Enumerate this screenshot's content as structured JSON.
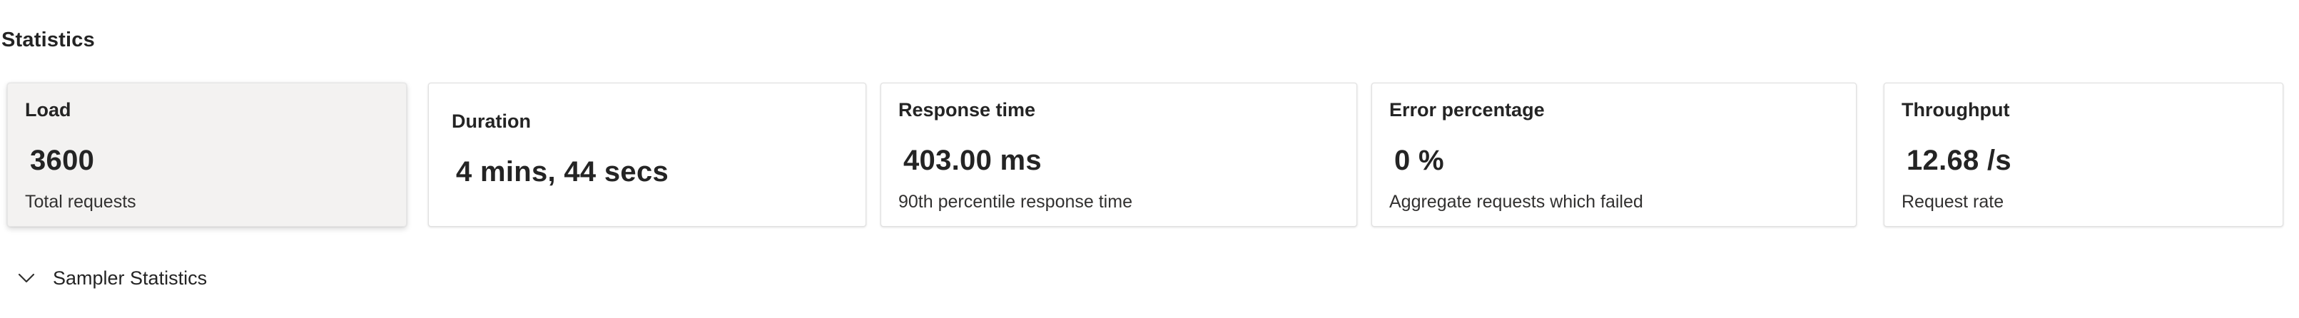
{
  "section": {
    "title": "Statistics"
  },
  "cards": [
    {
      "title": "Load",
      "value": "3600",
      "subtitle": "Total requests"
    },
    {
      "title": "Duration",
      "value": "4 mins, 44 secs",
      "subtitle": ""
    },
    {
      "title": "Response time",
      "value": "403.00 ms",
      "subtitle": "90th percentile response time"
    },
    {
      "title": "Error percentage",
      "value": "0 %",
      "subtitle": "Aggregate requests which failed"
    },
    {
      "title": "Throughput",
      "value": "12.68 /s",
      "subtitle": "Request rate"
    }
  ],
  "sampler": {
    "label": "Sampler Statistics",
    "icon": "chevron-down-icon"
  },
  "colors": {
    "text": "#242424",
    "selected_card_bg": "#f3f2f1",
    "card_border": "#e1e1e1"
  }
}
